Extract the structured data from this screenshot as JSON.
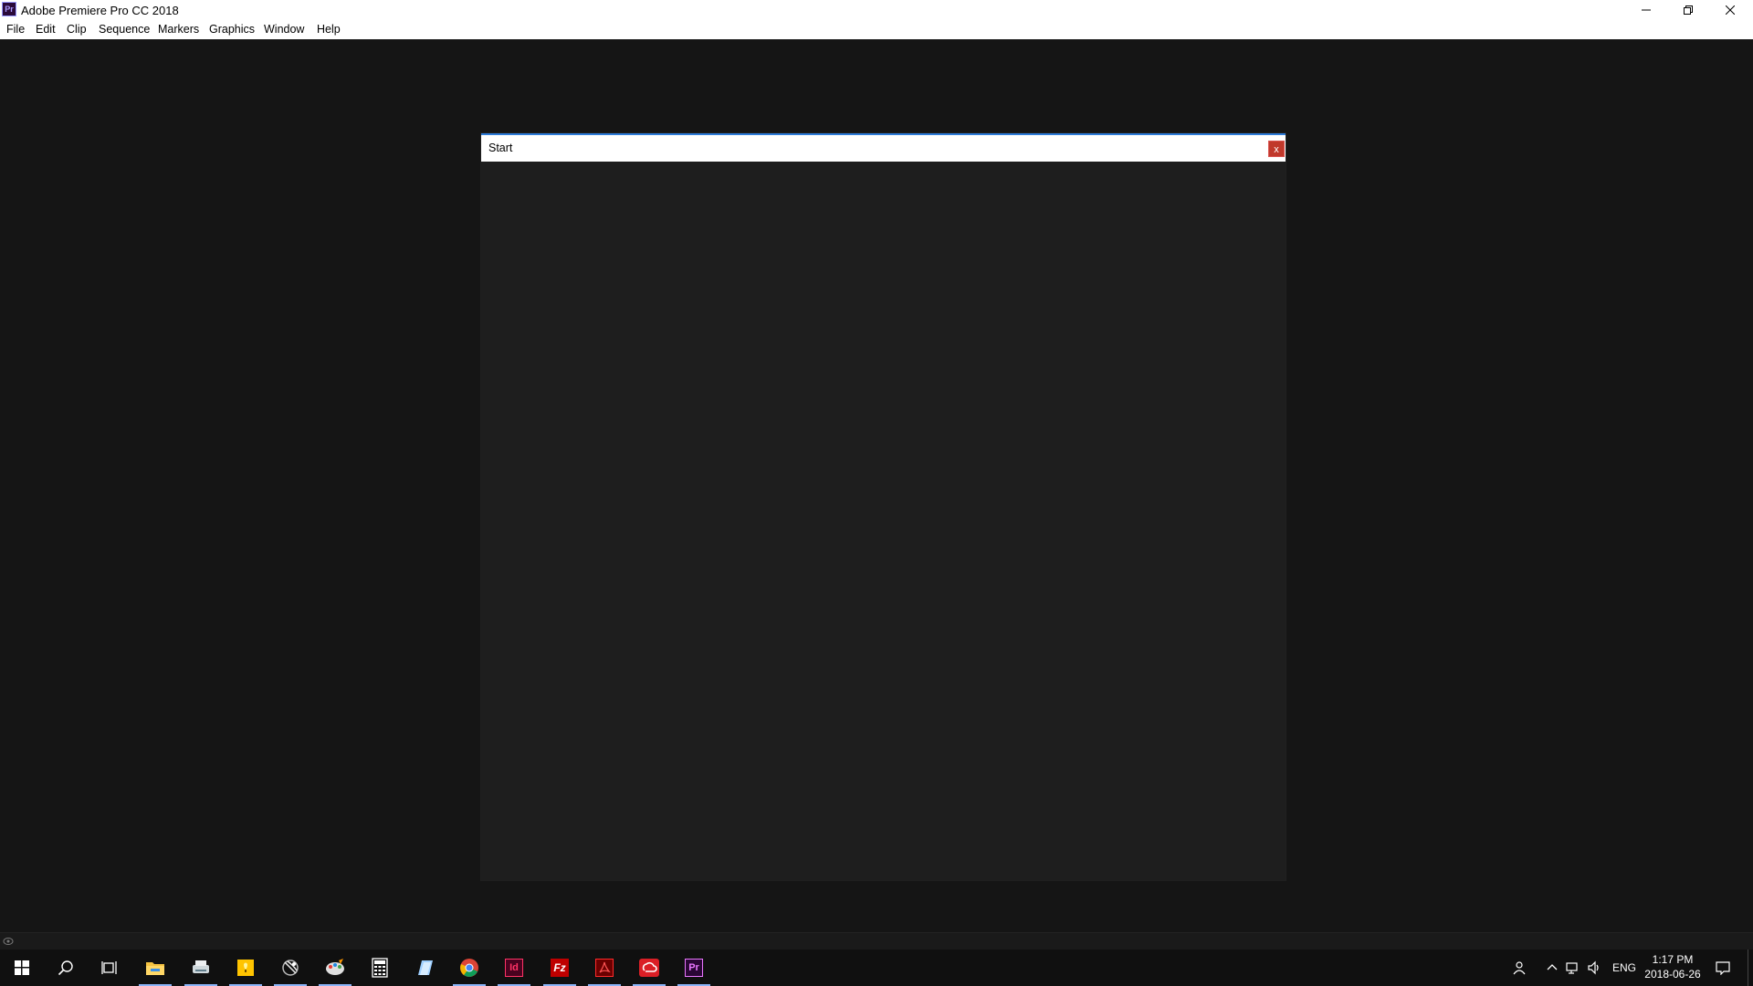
{
  "window": {
    "app_icon": "Pr",
    "title": "Adobe Premiere Pro CC 2018",
    "controls": [
      "minimize-icon",
      "restore-icon",
      "close-icon"
    ]
  },
  "menu": [
    "File",
    "Edit",
    "Clip",
    "Sequence",
    "Markers",
    "Graphics",
    "Window",
    "Help"
  ],
  "dialog": {
    "title": "Start",
    "close": "x"
  },
  "taskbar": {
    "apps": [
      {
        "name": "windows-start-icon",
        "active": false
      },
      {
        "name": "search-icon",
        "active": false
      },
      {
        "name": "task-view-icon",
        "active": false
      },
      {
        "name": "file-explorer-icon",
        "active": true
      },
      {
        "name": "scanner-icon",
        "active": true
      },
      {
        "name": "sticky-notes-icon",
        "active": true
      },
      {
        "name": "satellite-icon",
        "active": true
      },
      {
        "name": "paint-icon",
        "active": true
      },
      {
        "name": "calculator-icon",
        "active": false
      },
      {
        "name": "notes-app-icon",
        "active": false
      },
      {
        "name": "chrome-icon",
        "active": true
      },
      {
        "name": "indesign-icon",
        "label": "Id",
        "active": true
      },
      {
        "name": "filezilla-icon",
        "label": "Fz",
        "active": true
      },
      {
        "name": "acrobat-icon",
        "active": true
      },
      {
        "name": "creative-cloud-icon",
        "active": true
      },
      {
        "name": "premiere-icon",
        "label": "Pr",
        "active": true
      }
    ],
    "tray": {
      "language": "ENG",
      "time": "1:17 PM",
      "date": "2018-06-26"
    },
    "colors": {
      "accent": "#8ab4f8",
      "indesign": "#ff3366",
      "filezilla": "#bf0000",
      "premiere": "#ea77ff"
    }
  }
}
